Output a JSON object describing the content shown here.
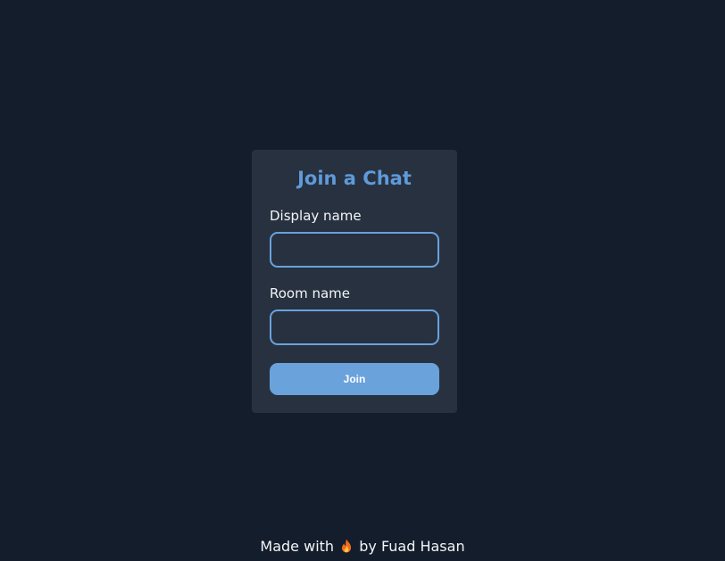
{
  "form": {
    "title": "Join a Chat",
    "display_name_label": "Display name",
    "display_name_value": "",
    "room_name_label": "Room name",
    "room_name_value": "",
    "join_label": "Join"
  },
  "footer": {
    "prefix": "Made with",
    "icon": "fire-icon",
    "suffix": "by Fuad Hasan"
  },
  "colors": {
    "background": "#131d2b",
    "card": "#273140",
    "accent": "#6aa2dc",
    "title": "#5f9ad9",
    "text": "#f3f5f8"
  }
}
